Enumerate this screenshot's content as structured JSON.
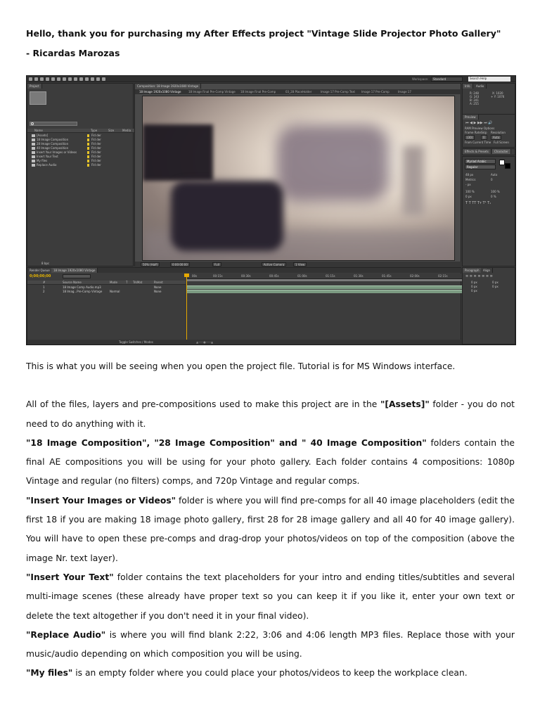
{
  "header": {
    "title": "Hello, thank you for purchasing my After Effects project \"Vintage Slide Projector Photo Gallery\"",
    "author": "- Ricardas Marozas"
  },
  "screenshot": {
    "workspace_label": "Workspace:",
    "workspace_value": "Standard",
    "help_search": "Search Help",
    "project_tab": "Project",
    "project_columns": [
      "Name",
      "Type",
      "Size",
      "Media"
    ],
    "project_items": [
      {
        "name": "[Assets]",
        "type": "Fld der"
      },
      {
        "name": "18 Image Composition",
        "type": "Fld der"
      },
      {
        "name": "28 Image Composition",
        "type": "Fld der"
      },
      {
        "name": "40 Image Composition",
        "type": "Fld der"
      },
      {
        "name": "Insert Your Images or Videos",
        "type": "Fld der"
      },
      {
        "name": "Insert Your Text",
        "type": "Fld der"
      },
      {
        "name": "My files",
        "type": "Fld der"
      },
      {
        "name": "Replace Audio",
        "type": "Fld der"
      }
    ],
    "project_bpc": "8 bpc",
    "comp_header": "Composition: 18 Image 1920x1080 Vintage",
    "comp_tabs": [
      "18 Image 1920x1080 Vintage",
      "18 Image Final Pre-Comp Vintage",
      "18 Image Final Pre-Comp",
      "03_28 PlaceHolder",
      "Image 17 Pre-Comp Text",
      "Image 17 Pre-Comp",
      "Image 17"
    ],
    "viewer_controls": [
      "50% (Half)",
      "0:00:00:00",
      "Full",
      "Active Camera",
      "1 View"
    ],
    "info_tab": "Info",
    "audio_tab": "Audio",
    "info_values": [
      "R: 248",
      "G: 243",
      "B: 241",
      "A: 255",
      "X: 1020",
      "+ Y: 1076"
    ],
    "preview_tab": "Preview",
    "preview_labels": [
      "RAM Preview Options",
      "Frame Rate",
      "Skip",
      "Resolution",
      "(30)",
      "0",
      "Auto",
      "From Current Time",
      "Full Screen"
    ],
    "effects_tab": "Effects & Presets",
    "character_tab": "Character",
    "font_name": "Myriad Arabic",
    "font_style": "Regular",
    "character_values": [
      "48 px",
      "Auto",
      "Metrics",
      "0",
      "- px",
      "100 %",
      "100 %",
      "0 px",
      "0 %"
    ],
    "paragraph_tab": "Paragraph",
    "align_tab": "Align",
    "paragraph_values": [
      "0 px",
      "0 px",
      "0 px",
      "0 px",
      "0 px"
    ],
    "timeline_tabs": [
      "Render Queue",
      "18 Image 1920x1080 Vintage"
    ],
    "timecode": "0;00;00;00",
    "timeline_columns": [
      "#",
      "Source Name",
      "Mode",
      "T",
      "TrkMat",
      "Parent"
    ],
    "layers": [
      {
        "num": "1",
        "name": "18 Image Comp Audio.mp3",
        "mode": "",
        "parent": "None"
      },
      {
        "num": "2",
        "name": "18 Imag...Pre-Comp Vintage",
        "mode": "Normal",
        "parent": "None"
      }
    ],
    "ruler_ticks": [
      "00s",
      "00:15s",
      "00:30s",
      "00:45s",
      "01:00s",
      "01:15s",
      "01:30s",
      "01:45s",
      "02:00s",
      "02:15s"
    ],
    "timeline_footer": "Toggle Switches / Modes"
  },
  "body": {
    "intro": "This is what you will be seeing when you open the project file. Tutorial is for MS Windows interface.",
    "p1_pre": "All of the files, layers and pre-compositions used to make this project are in the ",
    "p1_bold": "\"[Assets]\"",
    "p1_post": " folder - you do not need to do anything with it.",
    "p2_bold": "\"18 Image Composition\", \"28 Image Composition\" and \" 40 Image Composition\"",
    "p2_post": " folders contain the final AE compositions you will be using for your photo gallery. Each folder contains 4 compositions: 1080p Vintage and regular (no filters) comps, and 720p Vintage and regular comps.",
    "p3_bold": "\"Insert Your Images or Videos\"",
    "p3_post": " folder is where you will find pre-comps for all 40 image placeholders (edit the first 18 if you are making 18 image photo gallery, first 28 for 28 image gallery and all 40 for 40 image gallery). You will have to open these pre-comps and drag-drop your photos/videos on top of the composition (above the image Nr. text layer).",
    "p4_bold": "\"Insert Your Text\"",
    "p4_post": " folder contains the text placeholders for your intro and ending titles/subtitles and several multi-image scenes (these already have proper text so you can keep it if you like it, enter your own text or delete the text altogether if you don't need it in your final video).",
    "p5_bold": "\"Replace Audio\"",
    "p5_post": " is where you will find blank 2:22, 3:06 and 4:06 length MP3 files. Replace those with your music/audio depending on which composition you will be using.",
    "p6_bold": "\"My files\"",
    "p6_post": " is an empty folder where you could place your photos/videos to keep the workplace clean."
  }
}
